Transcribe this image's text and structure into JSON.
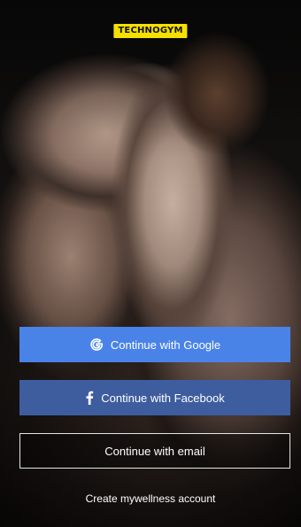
{
  "logo": {
    "text": "TECHNOGYM"
  },
  "buttons": {
    "google": {
      "label": "Continue with Google",
      "icon": "google-g-icon",
      "color": "#4a83e8"
    },
    "facebook": {
      "label": "Continue with Facebook",
      "icon": "facebook-f-icon",
      "color": "#3e5d9f"
    },
    "email": {
      "label": "Continue with email"
    }
  },
  "links": {
    "create_account": "Create mywellness account"
  },
  "colors": {
    "logo_yellow": "#f6e000"
  }
}
